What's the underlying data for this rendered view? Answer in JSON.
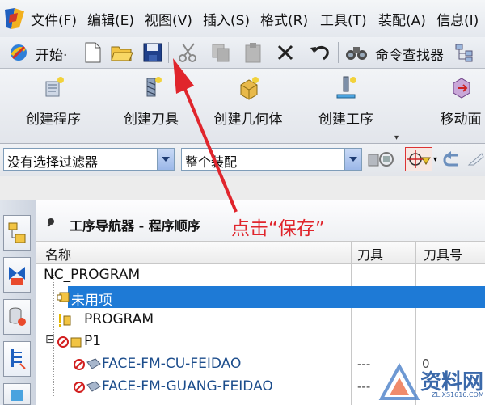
{
  "menubar": {
    "items": [
      {
        "label": "文件(F)"
      },
      {
        "label": "编辑(E)"
      },
      {
        "label": "视图(V)"
      },
      {
        "label": "插入(S)"
      },
      {
        "label": "格式(R)"
      },
      {
        "label": "工具(T)"
      },
      {
        "label": "装配(A)"
      },
      {
        "label": "信息(I)"
      }
    ]
  },
  "toolbar": {
    "start_label": "开始·",
    "finder_label": "命令查找器"
  },
  "big_toolbar": {
    "buttons": [
      {
        "label": "创建程序"
      },
      {
        "label": "创建刀具"
      },
      {
        "label": "创建几何体"
      },
      {
        "label": "创建工序"
      },
      {
        "label": "移动面"
      }
    ]
  },
  "filter_bar": {
    "selection_filter": "没有选择过滤器",
    "scope": "整个装配"
  },
  "annotation": {
    "text": "点击“保存”"
  },
  "navigator": {
    "title": "工序导航器 - 程序顺序",
    "columns": [
      "名称",
      "刀具",
      "刀具号"
    ],
    "rows": [
      {
        "name": "NC_PROGRAM",
        "tool": "",
        "tool_no": ""
      },
      {
        "name": "未用项",
        "tool": "",
        "tool_no": ""
      },
      {
        "name": "PROGRAM",
        "tool": "",
        "tool_no": ""
      },
      {
        "name": "P1",
        "tool": "",
        "tool_no": ""
      },
      {
        "name": "FACE-FM-CU-FEIDAO",
        "tool": "---",
        "tool_no": "0"
      },
      {
        "name": "FACE-FM-GUANG-FEIDAO",
        "tool": "---",
        "tool_no": ""
      }
    ]
  },
  "watermark": {
    "text": "资料网",
    "url": "ZL.XS1616.COM"
  },
  "colors": {
    "selection": "#1e7ad6",
    "annotation": "#e0252c"
  }
}
